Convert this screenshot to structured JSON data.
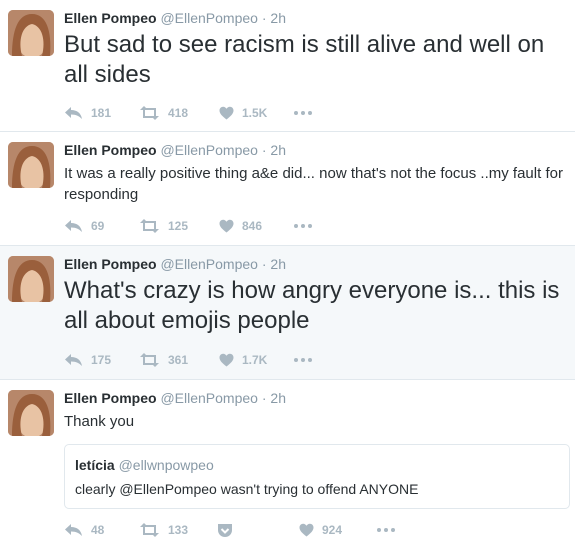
{
  "tweets": [
    {
      "name": "Ellen Pompeo",
      "handle": "@EllenPompeo",
      "time": "· 2h",
      "text": "But sad to see racism is still alive and well on all sides",
      "replies": "181",
      "retweets": "418",
      "likes": "1.5K"
    },
    {
      "name": "Ellen Pompeo",
      "handle": "@EllenPompeo",
      "time": "· 2h",
      "text": "It was a really positive thing a&e did... now that's not the focus ..my fault for responding",
      "replies": "69",
      "retweets": "125",
      "likes": "846"
    },
    {
      "name": "Ellen Pompeo",
      "handle": "@EllenPompeo",
      "time": "· 2h",
      "text": "What's crazy is how angry everyone is... this is all about emojis people",
      "replies": "175",
      "retweets": "361",
      "likes": "1.7K"
    },
    {
      "name": "Ellen Pompeo",
      "handle": "@EllenPompeo",
      "time": "· 2h",
      "text": "Thank you",
      "replies": "48",
      "retweets": "133",
      "likes": "924",
      "quote": {
        "name": "letícia",
        "handle": "@ellwnpowpeo",
        "text": "clearly @EllenPompeo wasn't trying to offend ANYONE"
      }
    }
  ],
  "icons": {
    "reply": "reply-icon",
    "retweet": "retweet-icon",
    "like": "heart-icon",
    "more": "more-icon",
    "pocket": "pocket-icon"
  },
  "colors": {
    "action_gray": "#aab8c2",
    "highlight_bg": "#f5f8fa",
    "divider": "#e1e8ed"
  }
}
